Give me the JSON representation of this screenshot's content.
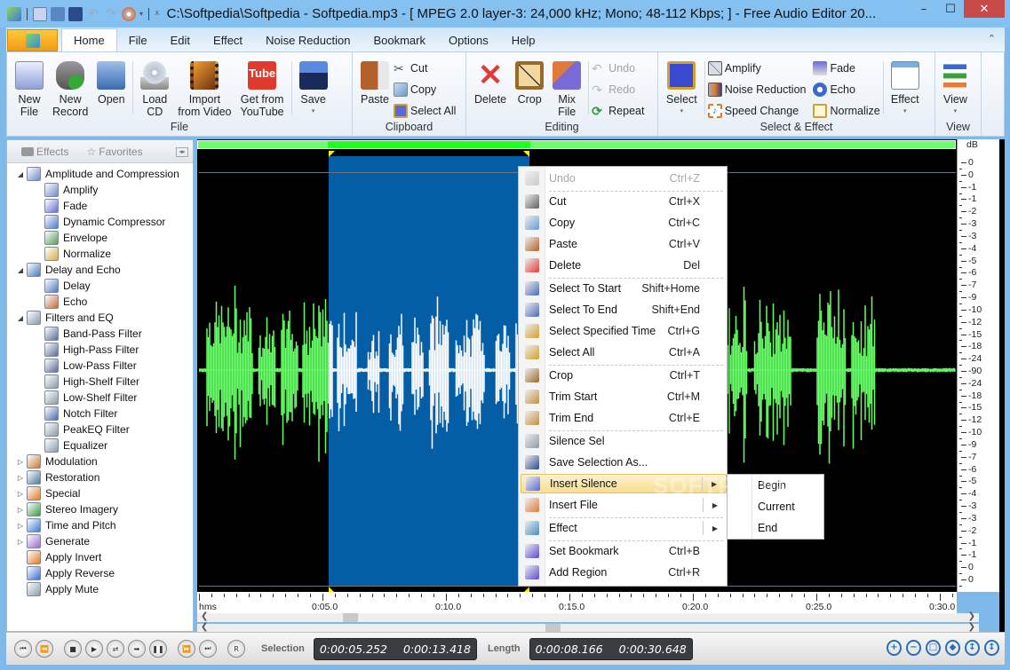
{
  "window": {
    "title": "C:\\Softpedia\\Softpedia - Softpedia.mp3 - [ MPEG 2.0 layer-3: 24,000 kHz; Mono; 48-112 Kbps;  ] - Free Audio Editor 20...",
    "minimize": "–",
    "maximize": "☐",
    "close": "✕"
  },
  "qat": [
    "app-icon",
    "new-file-icon",
    "open-icon",
    "save-icon",
    "undo-icon",
    "redo-icon",
    "cd-icon"
  ],
  "tabs": [
    "Home",
    "File",
    "Edit",
    "Effect",
    "Noise Reduction",
    "Bookmark",
    "Options",
    "Help"
  ],
  "active_tab": "Home",
  "ribbon": {
    "file": {
      "title": "File",
      "buttons": [
        {
          "label1": "New",
          "label2": "File",
          "icon": "new-file-icon",
          "color": "#8e9fd8"
        },
        {
          "label1": "New",
          "label2": "Record",
          "icon": "microphone-icon",
          "color": "#7a7a7a"
        },
        {
          "label1": "Open",
          "label2": "",
          "icon": "open-folder-icon",
          "color": "#5b86c6"
        },
        {
          "label1": "Load",
          "label2": "CD",
          "icon": "cd-drive-icon",
          "color": "#b0b0b0"
        },
        {
          "label1": "Import",
          "label2": "from Video",
          "icon": "film-icon",
          "color": "#a45a2a"
        },
        {
          "label1": "Get from",
          "label2": "YouTube",
          "icon": "youtube-icon",
          "color": "#e03a2e"
        },
        {
          "label1": "Save",
          "label2": "▾",
          "icon": "save-icon",
          "color": "#2a4a8a"
        }
      ]
    },
    "clipboard": {
      "title": "Clipboard",
      "paste": "Paste",
      "cut": "Cut",
      "copy": "Copy",
      "select_all": "Select All"
    },
    "editing": {
      "title": "Editing",
      "delete": "Delete",
      "crop": "Crop",
      "mix1": "Mix",
      "mix2": "File",
      "undo": "Undo",
      "redo": "Redo",
      "repeat": "Repeat"
    },
    "select_effect": {
      "title": "Select & Effect",
      "select": "Select",
      "amplify": "Amplify",
      "noise_reduction": "Noise Reduction",
      "speed_change": "Speed Change",
      "fade": "Fade",
      "echo": "Echo",
      "normalize": "Normalize",
      "effect": "Effect"
    },
    "view": {
      "title": "View",
      "view": "View"
    }
  },
  "left_panel": {
    "tab_effects": "Effects",
    "tab_favorites": "Favorites",
    "tree": [
      {
        "label": "Amplitude and Compression",
        "level": 1,
        "expanded": true,
        "color": "#6a8cc8"
      },
      {
        "label": "Amplify",
        "level": 2,
        "color": "#6a8cc8"
      },
      {
        "label": "Fade",
        "level": 2,
        "color": "#6a6ad8"
      },
      {
        "label": "Dynamic Compressor",
        "level": 2,
        "color": "#4a7ad0"
      },
      {
        "label": "Envelope",
        "level": 2,
        "color": "#5a9a5a"
      },
      {
        "label": "Normalize",
        "level": 2,
        "color": "#d0b050"
      },
      {
        "label": "Delay and Echo",
        "level": 1,
        "expanded": true,
        "color": "#4a78c0"
      },
      {
        "label": "Delay",
        "level": 2,
        "color": "#4a78c0"
      },
      {
        "label": "Echo",
        "level": 2,
        "color": "#c06a3a"
      },
      {
        "label": "Filters and EQ",
        "level": 1,
        "expanded": true,
        "color": "#8a9aa8"
      },
      {
        "label": "Band-Pass Filter",
        "level": 2,
        "color": "#5a6a9a"
      },
      {
        "label": "High-Pass Filter",
        "level": 2,
        "color": "#5a6a9a"
      },
      {
        "label": "Low-Pass Filter",
        "level": 2,
        "color": "#5a6a9a"
      },
      {
        "label": "High-Shelf Filter",
        "level": 2,
        "color": "#8a9aa8"
      },
      {
        "label": "Low-Shelf Filter",
        "level": 2,
        "color": "#8a9aa8"
      },
      {
        "label": "Notch Filter",
        "level": 2,
        "color": "#4a6ab0"
      },
      {
        "label": "PeakEQ Filter",
        "level": 2,
        "color": "#8a9aa8"
      },
      {
        "label": "Equalizer",
        "level": 2,
        "color": "#8a9aa8"
      },
      {
        "label": "Modulation",
        "level": 1,
        "expanded": false,
        "color": "#c87a3a"
      },
      {
        "label": "Restoration",
        "level": 1,
        "expanded": false,
        "color": "#4a7a9a"
      },
      {
        "label": "Special",
        "level": 1,
        "expanded": false,
        "color": "#e07a2a"
      },
      {
        "label": "Stereo Imagery",
        "level": 1,
        "expanded": false,
        "color": "#3a9a4a"
      },
      {
        "label": "Time and Pitch",
        "level": 1,
        "expanded": false,
        "color": "#3a7ad0"
      },
      {
        "label": "Generate",
        "level": 1,
        "expanded": false,
        "color": "#9a6ad0"
      },
      {
        "label": "Apply Invert",
        "level": 1,
        "leaf": true,
        "color": "#e07a2a"
      },
      {
        "label": "Apply Reverse",
        "level": 1,
        "leaf": true,
        "color": "#3a6ad0"
      },
      {
        "label": "Apply Mute",
        "level": 1,
        "leaf": true,
        "color": "#8a9aa8"
      }
    ]
  },
  "waveform": {
    "colors": {
      "wave": "#66ff66",
      "selection_bg": "#045ea6",
      "selection_wave": "#ffffff",
      "background": "#000000"
    },
    "duration_s": 30.648,
    "selection_start_s": 5.252,
    "selection_end_s": 13.418,
    "db_label": "dB",
    "db_ticks": [
      "0",
      "0",
      "-1",
      "-1",
      "-2",
      "-3",
      "-3",
      "-4",
      "-5",
      "-6",
      "-7",
      "-9",
      "-10",
      "-12",
      "-15",
      "-18",
      "-24",
      "-90",
      "-24",
      "-18",
      "-15",
      "-12",
      "-10",
      "-9",
      "-7",
      "-6",
      "-5",
      "-4",
      "-3",
      "-3",
      "-2",
      "-1",
      "-1",
      "0",
      "0"
    ],
    "time_unit": "hms",
    "time_labels": [
      "0:05.0",
      "0:10.0",
      "0:15.0",
      "0:20.0",
      "0:25.0",
      "0:30.0"
    ]
  },
  "context_menu": {
    "items": [
      {
        "label": "Undo",
        "shortcut": "Ctrl+Z",
        "disabled": true,
        "icon": "undo-icon",
        "color": "#cccccc"
      },
      {
        "sep": true
      },
      {
        "label": "Cut",
        "shortcut": "Ctrl+X",
        "icon": "scissors-icon",
        "color": "#606060"
      },
      {
        "label": "Copy",
        "shortcut": "Ctrl+C",
        "icon": "copy-icon",
        "color": "#6a9ad0"
      },
      {
        "label": "Paste",
        "shortcut": "Ctrl+V",
        "icon": "paste-icon",
        "color": "#b4602a"
      },
      {
        "label": "Delete",
        "shortcut": "Del",
        "icon": "delete-icon",
        "color": "#e03a3a"
      },
      {
        "sep": true
      },
      {
        "label": "Select To Start",
        "shortcut": "Shift+Home",
        "icon": "select-to-start-icon",
        "color": "#4a6ab8"
      },
      {
        "label": "Select To End",
        "shortcut": "Shift+End",
        "icon": "select-to-end-icon",
        "color": "#4a6ab8"
      },
      {
        "label": "Select Specified Time",
        "shortcut": "Ctrl+G",
        "icon": "select-time-icon",
        "color": "#d0a030"
      },
      {
        "label": "Select All",
        "shortcut": "Ctrl+A",
        "icon": "select-all-icon",
        "color": "#d0a030"
      },
      {
        "sep": true
      },
      {
        "label": "Crop",
        "shortcut": "Ctrl+T",
        "icon": "crop-icon",
        "color": "#9a6a2a"
      },
      {
        "label": "Trim Start",
        "shortcut": "Ctrl+M",
        "icon": "trim-start-icon",
        "color": "#c09040"
      },
      {
        "label": "Trim End",
        "shortcut": "Ctrl+E",
        "icon": "trim-end-icon",
        "color": "#c09040"
      },
      {
        "sep": true
      },
      {
        "label": "Silence Sel",
        "shortcut": "",
        "icon": "silence-icon",
        "color": "#8a9aa8"
      },
      {
        "label": "Save Selection As...",
        "shortcut": "",
        "icon": "save-selection-icon",
        "color": "#2a4a8a"
      },
      {
        "label": "Insert Silence",
        "shortcut": "",
        "submenu": true,
        "highlighted": true,
        "icon": "insert-silence-icon",
        "color": "#5a6ad0"
      },
      {
        "label": "Insert File",
        "shortcut": "",
        "submenu": true,
        "icon": "insert-file-icon",
        "color": "#e07a3a"
      },
      {
        "sep": true
      },
      {
        "label": "Effect",
        "shortcut": "",
        "submenu": true,
        "icon": "effect-icon",
        "color": "#4a8ac0"
      },
      {
        "sep": true
      },
      {
        "label": "Set Bookmark",
        "shortcut": "Ctrl+B",
        "icon": "bookmark-icon",
        "color": "#5a4ad0"
      },
      {
        "label": "Add Region",
        "shortcut": "Ctrl+R",
        "icon": "region-icon",
        "color": "#5a4ad0"
      }
    ],
    "submenu": [
      "Begin",
      "Current",
      "End"
    ]
  },
  "watermark": "SOFTPEDIA",
  "transport": {
    "buttons": [
      "go-start",
      "rewind",
      "stop",
      "play",
      "loop",
      "play-selection",
      "pause",
      "fast-forward",
      "go-end",
      "record"
    ],
    "glyphs": [
      "⏮",
      "⏪",
      "■",
      "▶",
      "⇄",
      "➡",
      "❚❚",
      "⏩",
      "⏭",
      "R"
    ],
    "selection_label": "Selection",
    "selection_start": "0:00:05.252",
    "selection_end": "0:00:13.418",
    "length_label": "Length",
    "length_sel": "0:00:08.166",
    "length_total": "0:00:30.648"
  },
  "zoom_buttons": [
    "zoom-in",
    "zoom-out",
    "zoom-selection",
    "zoom-all",
    "zoom-in-vertical",
    "zoom-out-vertical"
  ],
  "zoom_glyphs": [
    "+",
    "−",
    "□",
    "◆",
    "↕",
    "↕"
  ]
}
